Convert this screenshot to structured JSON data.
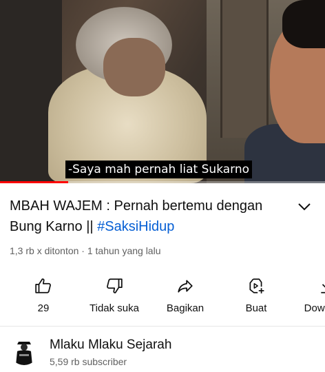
{
  "video": {
    "caption": "-Saya mah pernah liat Sukarno",
    "progress_fraction": 0.21
  },
  "title": {
    "text": "MBAH WAJEM : Pernah bertemu dengan Bung Karno || ",
    "hashtag": "#SaksiHidup"
  },
  "meta": {
    "text": "1,3 rb x ditonton · 1 tahun yang lalu"
  },
  "actions": {
    "like_count": "29",
    "dislike_label": "Tidak suka",
    "share_label": "Bagikan",
    "create_label": "Buat",
    "download_label": "Download"
  },
  "channel": {
    "name": "Mlaku Mlaku Sejarah",
    "subscribers": "5,59 rb subscriber"
  },
  "icons": {
    "expand": "chevron-down-icon",
    "like": "thumbs-up-icon",
    "dislike": "thumbs-down-icon",
    "share": "share-arrow-icon",
    "create": "create-clip-icon",
    "download": "download-icon"
  },
  "colors": {
    "hashtag": "#065fd4",
    "progress": "#ff0000",
    "meta_text": "#606060"
  }
}
